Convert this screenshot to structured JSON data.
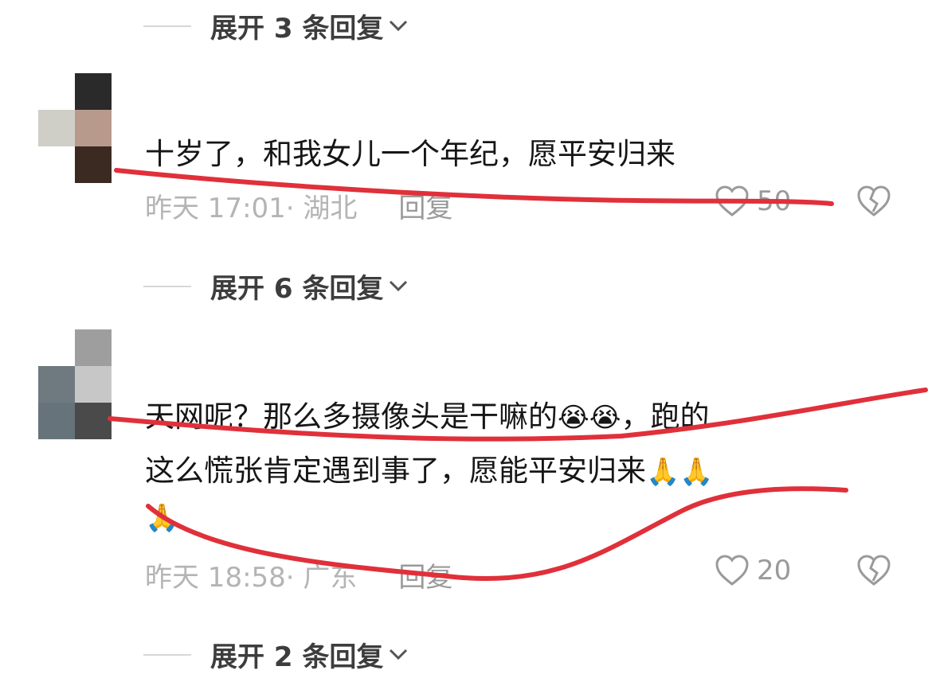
{
  "expand_rows": [
    {
      "label": "展开 3 条回复"
    },
    {
      "label": "展开 6 条回复"
    },
    {
      "label": "展开 2 条回复"
    }
  ],
  "comments": [
    {
      "line1": "十岁了，和我女儿一个年纪，愿平安归来",
      "time": "昨天 17:01",
      "location": "· 湖北",
      "reply_label": "回复",
      "likes": "50"
    },
    {
      "line1": "天网呢？那么多摄像头是干嘛的",
      "line1_tail": "，跑的",
      "line2": "这么慌张肯定遇到事了，愿能平安归来",
      "emoji_cry": "😭",
      "emoji_pray": "🙏",
      "time": "昨天 18:58",
      "location": "· 广东",
      "reply_label": "回复",
      "likes": "20"
    }
  ],
  "icons": {
    "like": "heart-outline-icon",
    "dislike": "broken-heart-icon",
    "expand": "chevron-down-icon"
  },
  "colors": {
    "annotation_red": "#e0303a",
    "meta_gray": "#b4b4b4",
    "text_dark": "#161616"
  }
}
